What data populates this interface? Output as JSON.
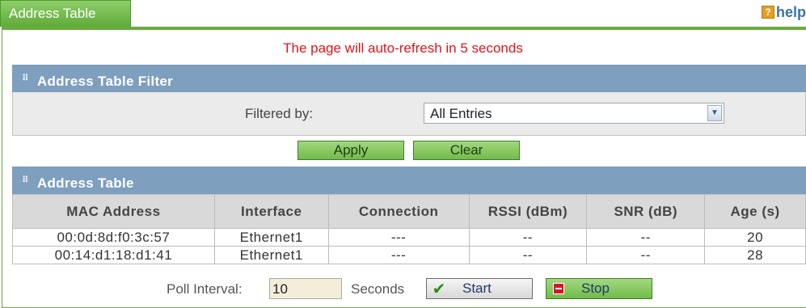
{
  "tab": {
    "title": "Address Table"
  },
  "help": {
    "label": "help"
  },
  "notice": "The page will auto-refresh in 5 seconds",
  "filter": {
    "section_title": "Address Table Filter",
    "label": "Filtered by:",
    "selected": "All Entries"
  },
  "buttons": {
    "apply": "Apply",
    "clear": "Clear"
  },
  "table": {
    "section_title": "Address Table",
    "columns": [
      "MAC Address",
      "Interface",
      "Connection",
      "RSSI (dBm)",
      "SNR (dB)",
      "Age (s)"
    ],
    "rows": [
      [
        "00:0d:8d:f0:3c:57",
        "Ethernet1",
        "---",
        "--",
        "--",
        "20"
      ],
      [
        "00:14:d1:18:d1:41",
        "Ethernet1",
        "---",
        "--",
        "--",
        "28"
      ]
    ]
  },
  "poll": {
    "label": "Poll Interval:",
    "value": "10",
    "unit": "Seconds",
    "start": "Start",
    "stop": "Stop"
  },
  "colors": {
    "tab_green": "#6aab3e",
    "section_blue": "#7e9fbe",
    "notice_red": "#e0141b"
  }
}
